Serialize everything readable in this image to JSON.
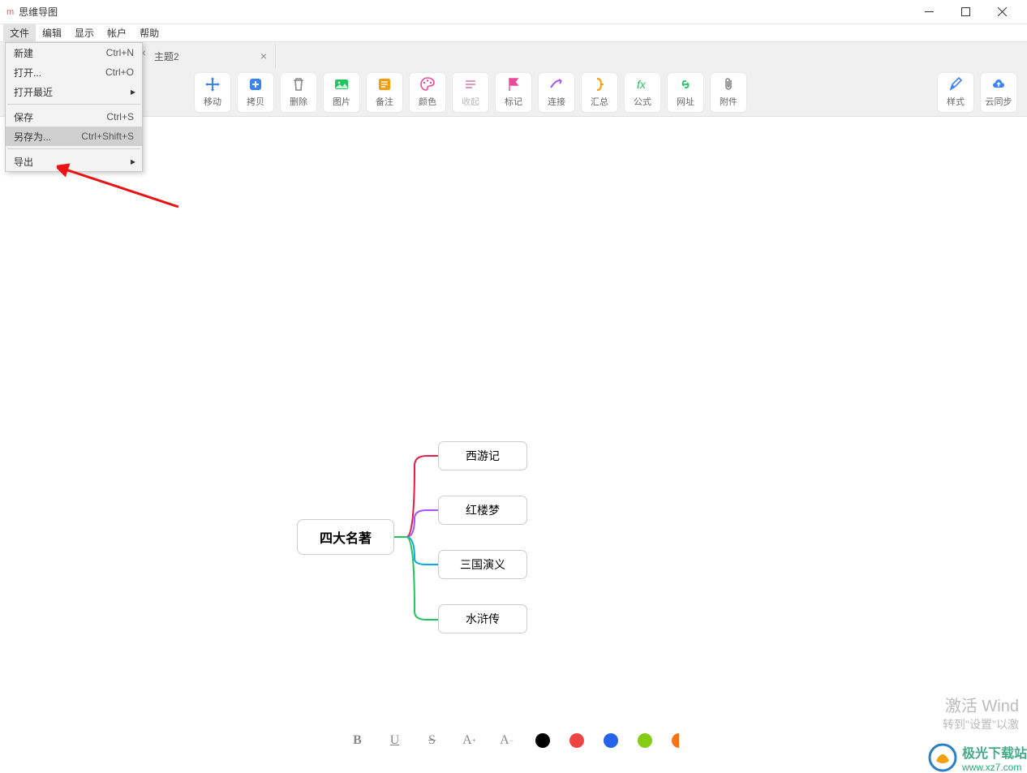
{
  "window": {
    "title": "思维导图"
  },
  "menubar": {
    "items": [
      "文件",
      "编辑",
      "显示",
      "帐户",
      "帮助"
    ]
  },
  "file_menu": {
    "new": {
      "label": "新建",
      "shortcut": "Ctrl+N"
    },
    "open": {
      "label": "打开...",
      "shortcut": "Ctrl+O"
    },
    "open_recent": {
      "label": "打开最近"
    },
    "save": {
      "label": "保存",
      "shortcut": "Ctrl+S"
    },
    "save_as": {
      "label": "另存为...",
      "shortcut": "Ctrl+Shift+S"
    },
    "export": {
      "label": "导出"
    }
  },
  "tabs": {
    "tab1": "主题2"
  },
  "toolbar": {
    "move": "移动",
    "copy": "拷贝",
    "delete": "删除",
    "image": "图片",
    "note": "备注",
    "color": "颜色",
    "collapse": "收起",
    "mark": "标记",
    "connect": "连接",
    "summary": "汇总",
    "formula": "公式",
    "url": "网址",
    "attach": "附件",
    "style": "样式",
    "cloud": "云同步"
  },
  "mindmap": {
    "root": "四大名著",
    "children": [
      "西游记",
      "红楼梦",
      "三国演义",
      "水浒传"
    ]
  },
  "bottom": {
    "bold": "B",
    "underline": "U",
    "strike": "S",
    "inc": "A",
    "dec": "A"
  },
  "watermark": {
    "big": "激活 Wind",
    "small": "转到\"设置\"以激",
    "name": "极光下载站",
    "url": "www.xz7.com"
  }
}
